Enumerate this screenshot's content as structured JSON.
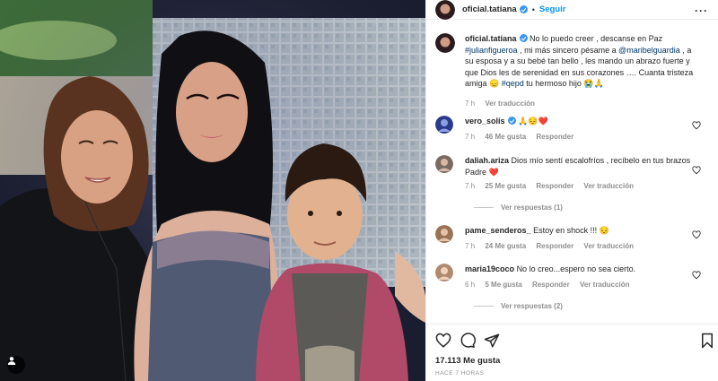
{
  "post": {
    "username": "oficial.tatiana",
    "separator": "•",
    "follow_label": "Seguir",
    "more_icon": "more-horizontal-icon",
    "image": {
      "description_icon": "user-tag-icon"
    }
  },
  "caption": {
    "username": "oficial.tatiana",
    "text_1": "No lo puedo creer , descanse en Paz",
    "mention_1": "#julianfigueroa",
    "text_2": ", mi más sincero pésame a",
    "mention_2": "@maribelguardia",
    "text_3": ", a su esposa y a su bebé tan bello , les mando un abrazo fuerte y que Dios les de serenidad en sus corazones …. Cuanta tristeza amiga 😞",
    "mention_3": "#qepd",
    "text_4": "tu hermoso hijo 😭🙏",
    "time": "7 h",
    "see_translation": "Ver traducción"
  },
  "comments": [
    {
      "username": "vero_solis",
      "verified": true,
      "text": "🙏😔❤️",
      "time": "7 h",
      "likes": "46 Me gusta",
      "reply": "Responder",
      "avatar_color": "#2b3a8a"
    },
    {
      "username": "daliah.ariza",
      "verified": false,
      "text": "Dios mío sentí escalofríos , recíbelo en tus brazos Padre ❤️",
      "time": "7 h",
      "likes": "25 Me gusta",
      "reply": "Responder",
      "see_translation": "Ver traducción",
      "replies_label": "Ver respuestas (1)",
      "avatar_color": "#7a6a62"
    },
    {
      "username": "pame_senderos_",
      "verified": false,
      "text": "Estoy en shock !!! 😔",
      "time": "7 h",
      "likes": "24 Me gusta",
      "reply": "Responder",
      "see_translation": "Ver traducción",
      "avatar_color": "#9a7356"
    },
    {
      "username": "maria19coco",
      "verified": false,
      "text": "No lo creo...espero no sea cierto.",
      "time": "6 h",
      "likes": "5 Me gusta",
      "reply": "Responder",
      "see_translation": "Ver traducción",
      "replies_label": "Ver respuestas (2)",
      "avatar_color": "#b08a70"
    }
  ],
  "footer": {
    "likes": "17.113 Me gusta",
    "time": "HACE 7 HORAS",
    "icons": [
      "heart-icon",
      "comment-icon",
      "share-icon",
      "bookmark-icon"
    ]
  },
  "colors": {
    "link": "#00376b",
    "accent": "#0095f6",
    "verified": "#3897f0",
    "heart_red": "#ed4956"
  }
}
